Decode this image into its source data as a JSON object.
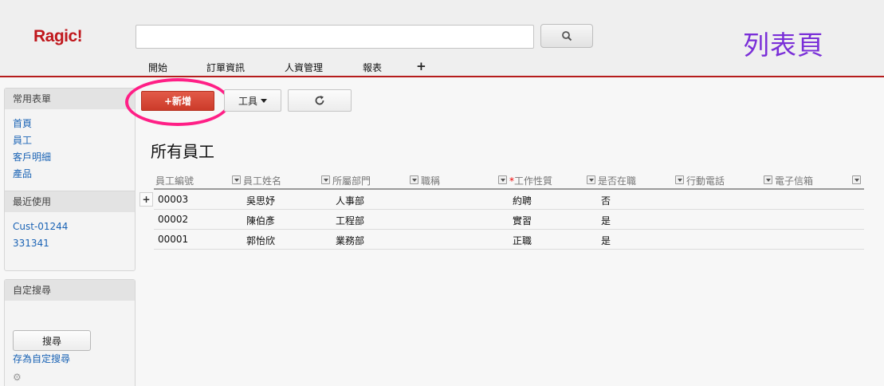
{
  "app": {
    "logo": "Ragic!"
  },
  "search": {
    "value": "",
    "placeholder": ""
  },
  "caption": "列表頁",
  "nav": {
    "items": [
      "開始",
      "訂單資訊",
      "人資管理",
      "報表"
    ],
    "add_label": "+"
  },
  "sidebar": {
    "frequent": {
      "title": "常用表單",
      "links": [
        "首頁",
        "員工",
        "客戶明細",
        "產品"
      ]
    },
    "recent": {
      "title": "最近使用",
      "links": [
        "Cust-01244",
        "331341"
      ]
    },
    "custom_search": {
      "title": "自定搜尋",
      "button": "搜尋",
      "save_link": "存為自定搜尋",
      "gear_icon": "gear-icon"
    }
  },
  "toolbar": {
    "new_label": "+新增",
    "tools_label": "工具",
    "refresh_icon": "refresh-icon"
  },
  "sheet": {
    "title": "所有員工"
  },
  "table": {
    "columns": [
      {
        "label": "員工編號",
        "required": false
      },
      {
        "label": "員工姓名",
        "required": false
      },
      {
        "label": "所屬部門",
        "required": false
      },
      {
        "label": "職稱",
        "required": false
      },
      {
        "label": "工作性質",
        "required": true
      },
      {
        "label": "是否在職",
        "required": false
      },
      {
        "label": "行動電話",
        "required": false
      },
      {
        "label": "電子信箱",
        "required": false
      }
    ],
    "required_mark": "*",
    "rows": [
      [
        "00003",
        "吳思妤",
        "人事部",
        "",
        "約聘",
        "否",
        "",
        ""
      ],
      [
        "00002",
        "陳伯彥",
        "工程部",
        "",
        "實習",
        "是",
        "",
        ""
      ],
      [
        "00001",
        "郭怡欣",
        "業務部",
        "",
        "正職",
        "是",
        "",
        ""
      ]
    ],
    "row_expand_label": "+"
  },
  "colors": {
    "accent_red": "#c0171c",
    "new_button": "#d84535",
    "link_blue": "#1a63b5",
    "caption_purple": "#7a2fd8",
    "highlight_pink": "#ff1f86"
  }
}
